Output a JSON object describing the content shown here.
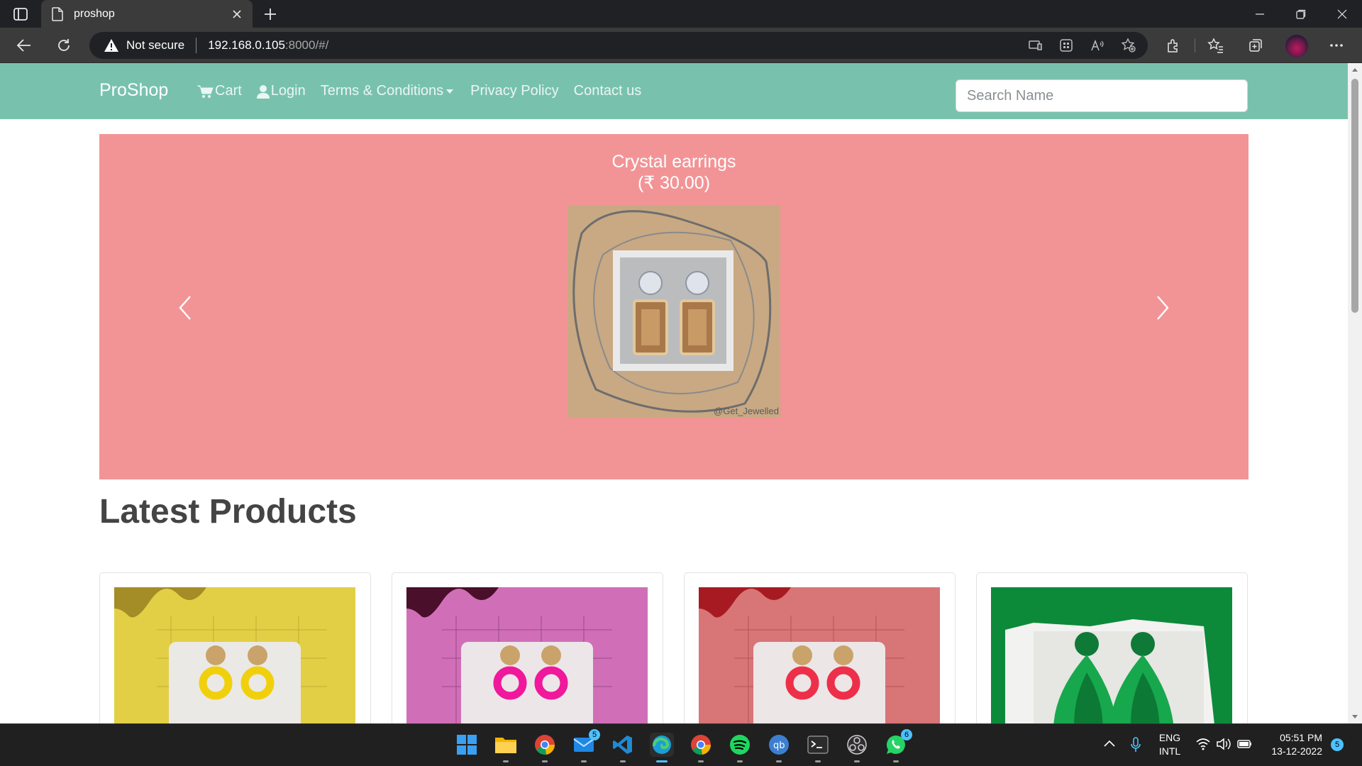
{
  "browser": {
    "tab_title": "proshop",
    "security_label": "Not secure",
    "url_host": "192.168.0.105",
    "url_path": ":8000/#/"
  },
  "site": {
    "brand": "ProShop",
    "nav": {
      "cart": "Cart",
      "login": "Login",
      "terms": "Terms & Conditions",
      "privacy": "Privacy Policy",
      "contact": "Contact us"
    },
    "search_placeholder": "Search Name",
    "carousel": {
      "title": "Crystal earrings",
      "price": "(₹ 30.00)",
      "watermark": "@Get_Jewelled"
    },
    "section_title": "Latest Products",
    "products": [
      {
        "color": "#e3cf45",
        "accent": "#f5d90f"
      },
      {
        "color": "#d06fb8",
        "accent": "#f0189b"
      },
      {
        "color": "#d77577",
        "accent": "#ee2f4a"
      },
      {
        "color": "#0c8a3a",
        "accent": "#17a84d"
      }
    ]
  },
  "taskbar": {
    "mail_badge": "5",
    "whatsapp_badge": "6",
    "lang_top": "ENG",
    "lang_bottom": "INTL",
    "time": "05:51 PM",
    "date": "13-12-2022",
    "notif_count": "5"
  },
  "colors": {
    "navbar": "#78c2ad",
    "carousel_bg": "#f29496",
    "taskbar": "#202020"
  }
}
